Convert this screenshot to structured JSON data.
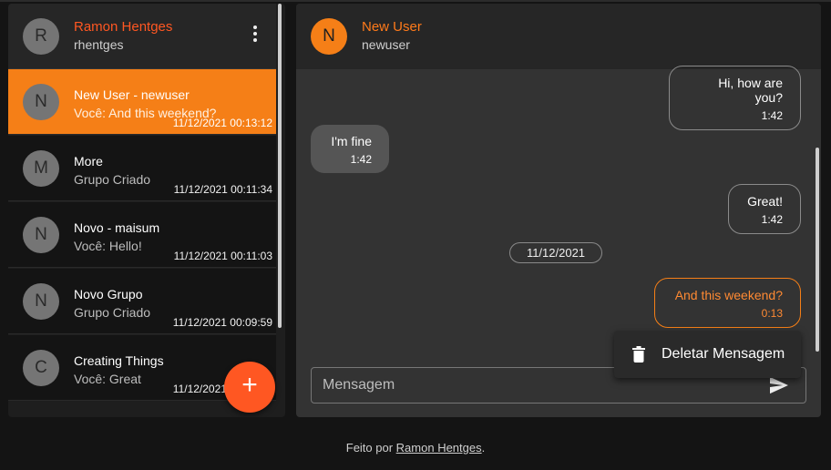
{
  "user": {
    "initial": "R",
    "name": "Ramon Hentges",
    "username": "rhentges"
  },
  "conversations": [
    {
      "initial": "N",
      "title": "New User - newuser",
      "subtitle": "Você: And this weekend?",
      "time": "11/12/2021 00:13:12",
      "active": true
    },
    {
      "initial": "M",
      "title": "More",
      "subtitle": "Grupo Criado",
      "time": "11/12/2021 00:11:34",
      "active": false
    },
    {
      "initial": "N",
      "title": "Novo - maisum",
      "subtitle": "Você: Hello!",
      "time": "11/12/2021 00:11:03",
      "active": false
    },
    {
      "initial": "N",
      "title": "Novo Grupo",
      "subtitle": "Grupo Criado",
      "time": "11/12/2021 00:09:59",
      "active": false
    },
    {
      "initial": "C",
      "title": "Creating Things",
      "subtitle": "Você: Great",
      "time": "11/12/2021 00:08:57",
      "active": false
    }
  ],
  "fab": {
    "label": "+"
  },
  "chat": {
    "initial": "N",
    "name": "New User",
    "username": "newuser",
    "messages": [
      {
        "text": "Hi, how are you?",
        "time": "1:42",
        "direction": "out"
      },
      {
        "text": "I'm fine",
        "time": "1:42",
        "direction": "in"
      },
      {
        "text": "Great!",
        "time": "1:42",
        "direction": "out"
      },
      {
        "text": "And this weekend?",
        "time": "0:13",
        "direction": "out"
      }
    ],
    "date_chip": "11/12/2021",
    "context_menu": {
      "delete_label": "Deletar Mensagem",
      "icon": "trash-icon"
    },
    "input": {
      "placeholder": "Mensagem",
      "value": ""
    }
  },
  "footer": {
    "prefix": "Feito por ",
    "author": "Ramon Hentges",
    "suffix": "."
  },
  "colors": {
    "accent": "#f57f17",
    "fab": "#ff5722",
    "background": "#141414",
    "panel": "#333333"
  }
}
